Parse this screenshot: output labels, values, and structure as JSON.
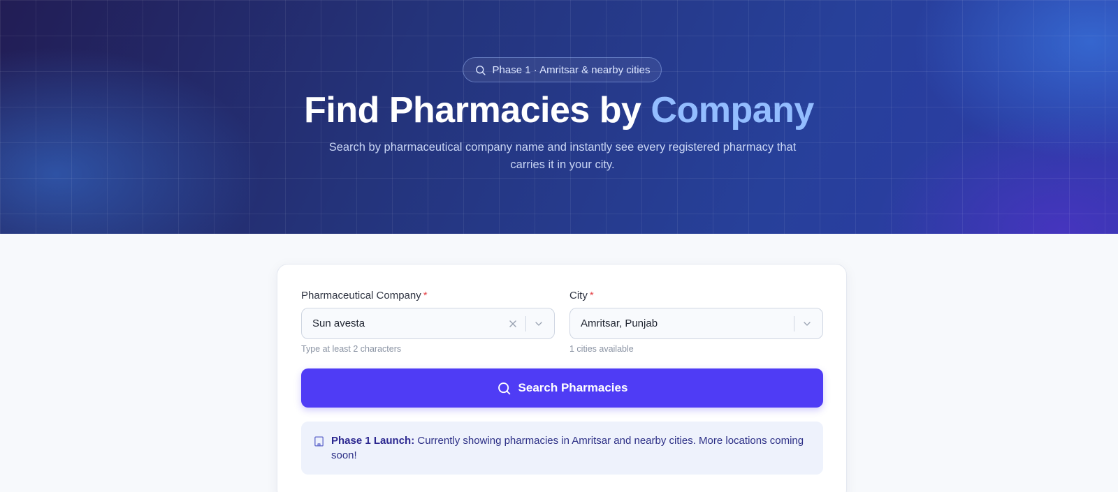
{
  "hero": {
    "badge": "Phase 1 · Amritsar & nearby cities",
    "title_main": "Find Pharmacies by ",
    "title_accent": "Company",
    "subtitle": "Search by pharmaceutical company name and instantly see every registered pharmacy that carries it in your city."
  },
  "form": {
    "company": {
      "label": "Pharmaceutical Company",
      "required_mark": "*",
      "value": "Sun avesta",
      "hint": "Type at least 2 characters"
    },
    "city": {
      "label": "City",
      "required_mark": "*",
      "value": "Amritsar, Punjab",
      "hint": "1 cities available"
    },
    "search_button": "Search Pharmacies"
  },
  "notice": {
    "title": "Phase 1 Launch:",
    "text": " Currently showing pharmacies in Amritsar and nearby cities. More locations coming soon!"
  },
  "colors": {
    "accent": "#4f3cf5",
    "title_accent": "#93bdff",
    "required": "#e5484d"
  }
}
